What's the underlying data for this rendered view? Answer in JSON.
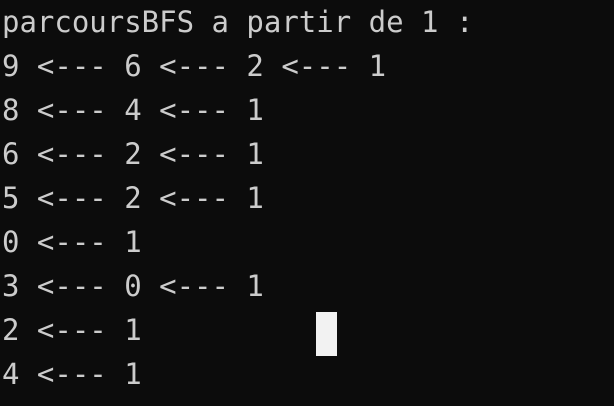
{
  "console": {
    "lines": [
      "parcoursBFS a partir de 1 :",
      "9 <--- 6 <--- 2 <--- 1",
      "8 <--- 4 <--- 1",
      "6 <--- 2 <--- 1",
      "5 <--- 2 <--- 1",
      "0 <--- 1",
      "3 <--- 0 <--- 1",
      "2 <--- 1",
      "4 <--- 1"
    ]
  },
  "colors": {
    "background": "#0c0c0c",
    "text": "#cccccc",
    "cursor": "#f2f2f2"
  }
}
